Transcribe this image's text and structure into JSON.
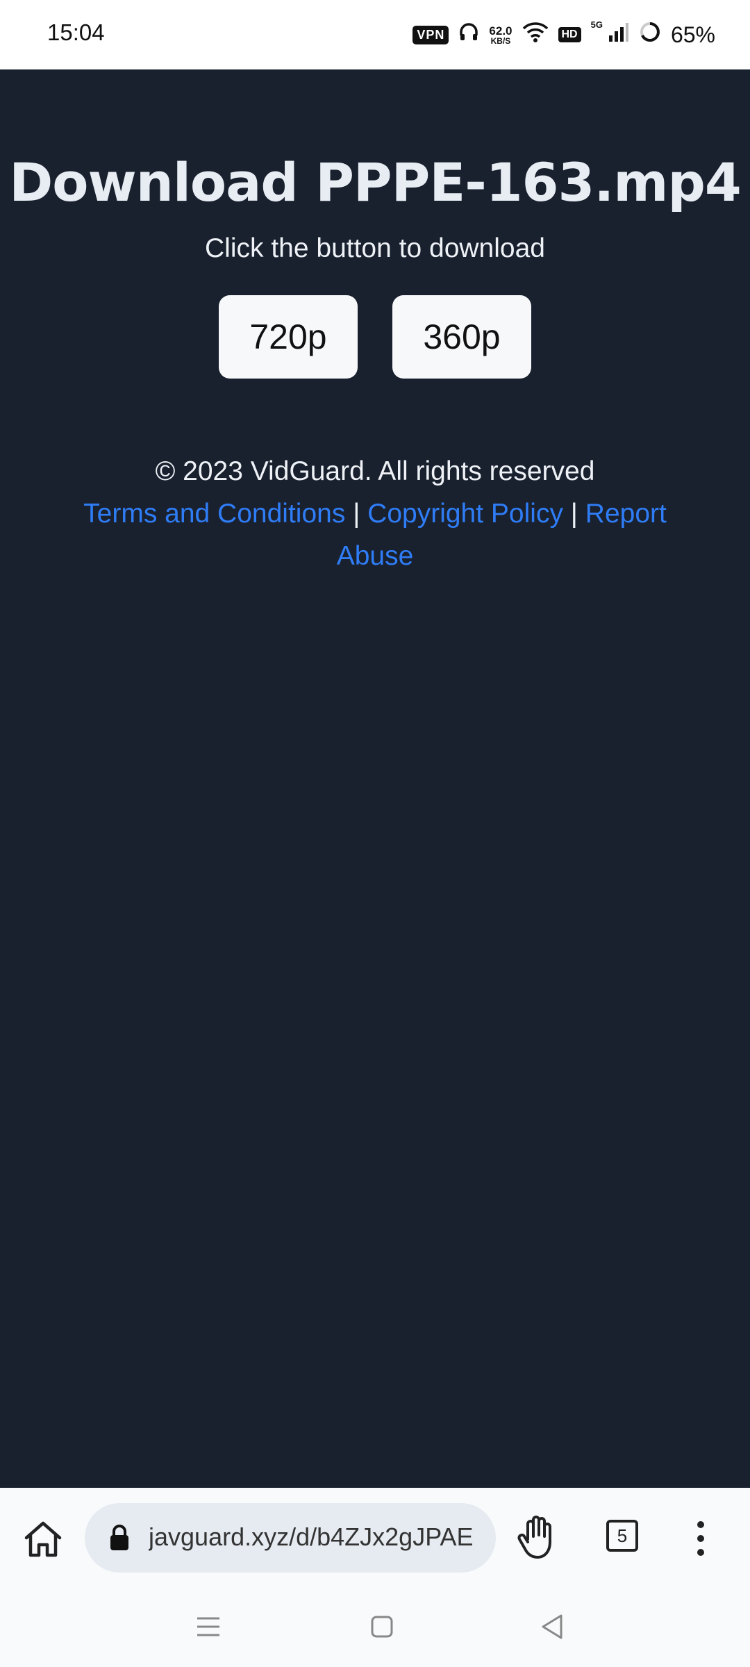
{
  "status_bar": {
    "time": "15:04",
    "vpn": "VPN",
    "net_speed": "62.0",
    "net_unit": "KB/S",
    "hd": "HD",
    "signal_type": "5G",
    "battery": "65%"
  },
  "page": {
    "title": "Download PPPE-163.mp4",
    "subtitle": "Click the button to download",
    "buttons": [
      {
        "label": "720p"
      },
      {
        "label": "360p"
      }
    ],
    "footer": {
      "copyright": "© 2023 VidGuard. All rights reserved",
      "links": [
        "Terms and Conditions",
        "Copyright Policy",
        "Report Abuse"
      ],
      "separator": "|"
    },
    "background_color": "#19202e",
    "link_color": "#2f7df6"
  },
  "browser": {
    "url": "javguard.xyz/d/b4ZJx2gJPAE",
    "tab_count": "5"
  }
}
